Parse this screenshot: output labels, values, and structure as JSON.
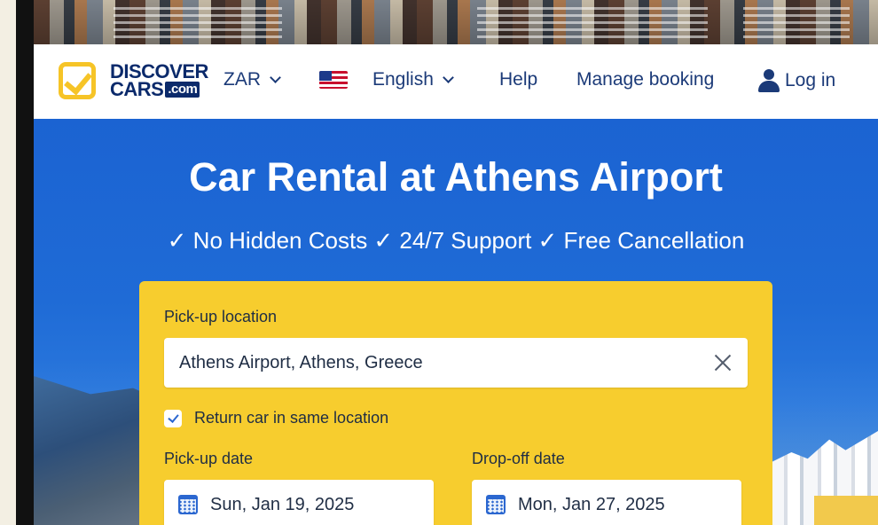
{
  "header": {
    "logo": {
      "line1": "DISCOVER",
      "line2": "CARS",
      "suffix": ".com"
    },
    "currency": "ZAR",
    "language": "English",
    "help": "Help",
    "manage_booking": "Manage booking",
    "login": "Log in"
  },
  "hero": {
    "title": "Car Rental at Athens Airport",
    "subtitle": "✓ No Hidden Costs ✓ 24/7 Support ✓ Free Cancellation"
  },
  "search": {
    "pickup_location_label": "Pick-up location",
    "pickup_location_value": "Athens Airport, Athens, Greece",
    "same_location_checked": true,
    "same_location_label": "Return car in same location",
    "pickup_date_label": "Pick-up date",
    "pickup_date_value": "Sun, Jan 19, 2025",
    "dropoff_date_label": "Drop-off date",
    "dropoff_date_value": "Mon, Jan 27, 2025"
  },
  "colors": {
    "brand_navy": "#0b2a6b",
    "brand_yellow": "#f7cd2e",
    "hero_blue": "#1b63d2"
  }
}
